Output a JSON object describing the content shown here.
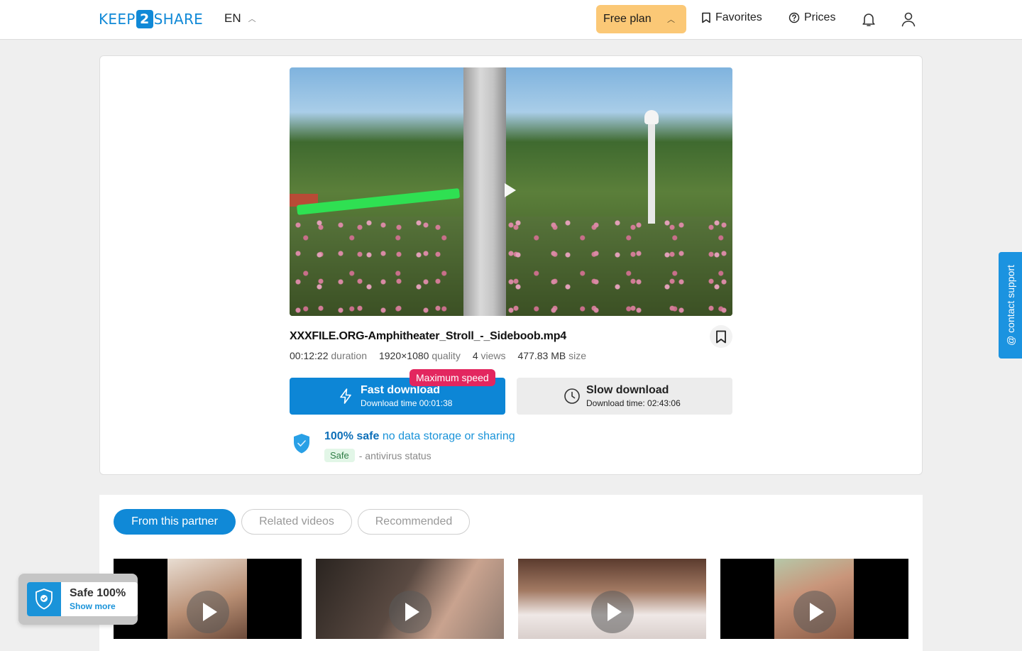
{
  "header": {
    "logo": {
      "part1": "KEEP",
      "part2": "2",
      "part3": "SHARE"
    },
    "language": "EN",
    "plan_label": "Free plan",
    "favorites_label": "Favorites",
    "prices_label": "Prices"
  },
  "file": {
    "name": "XXXFILE.ORG-Amphitheater_Stroll_-_Sideboob.mp4",
    "duration_value": "00:12:22",
    "duration_label": "duration",
    "quality_value": "1920×1080",
    "quality_label": "quality",
    "views_value": "4",
    "views_label": "views",
    "size_value": "477.83 MB",
    "size_label": "size"
  },
  "download": {
    "badge": "Maximum speed",
    "fast_title": "Fast download",
    "fast_time": "Download time 00:01:38",
    "slow_title": "Slow download",
    "slow_time": "Download time: 02:43:06"
  },
  "safety": {
    "strong": "100% safe",
    "light": "no data storage or sharing",
    "badge": "Safe",
    "status_text": "- antivirus status"
  },
  "support_label": "@ contact support",
  "tabs": [
    "From this partner",
    "Related videos",
    "Recommended"
  ],
  "safe_widget": {
    "title": "Safe 100%",
    "link": "Show more"
  },
  "icons": {
    "bookmark": "bookmark-icon",
    "help": "question-circle-icon",
    "bell": "bell-icon",
    "user": "user-icon",
    "bolt": "lightning-icon",
    "clock": "clock-icon",
    "shield": "shield-check-icon",
    "play": "play-icon"
  },
  "colors": {
    "brand": "#1089d7",
    "plan": "#fbc876",
    "badge_red": "#e3265f",
    "safe_green": "#2e7d45"
  }
}
